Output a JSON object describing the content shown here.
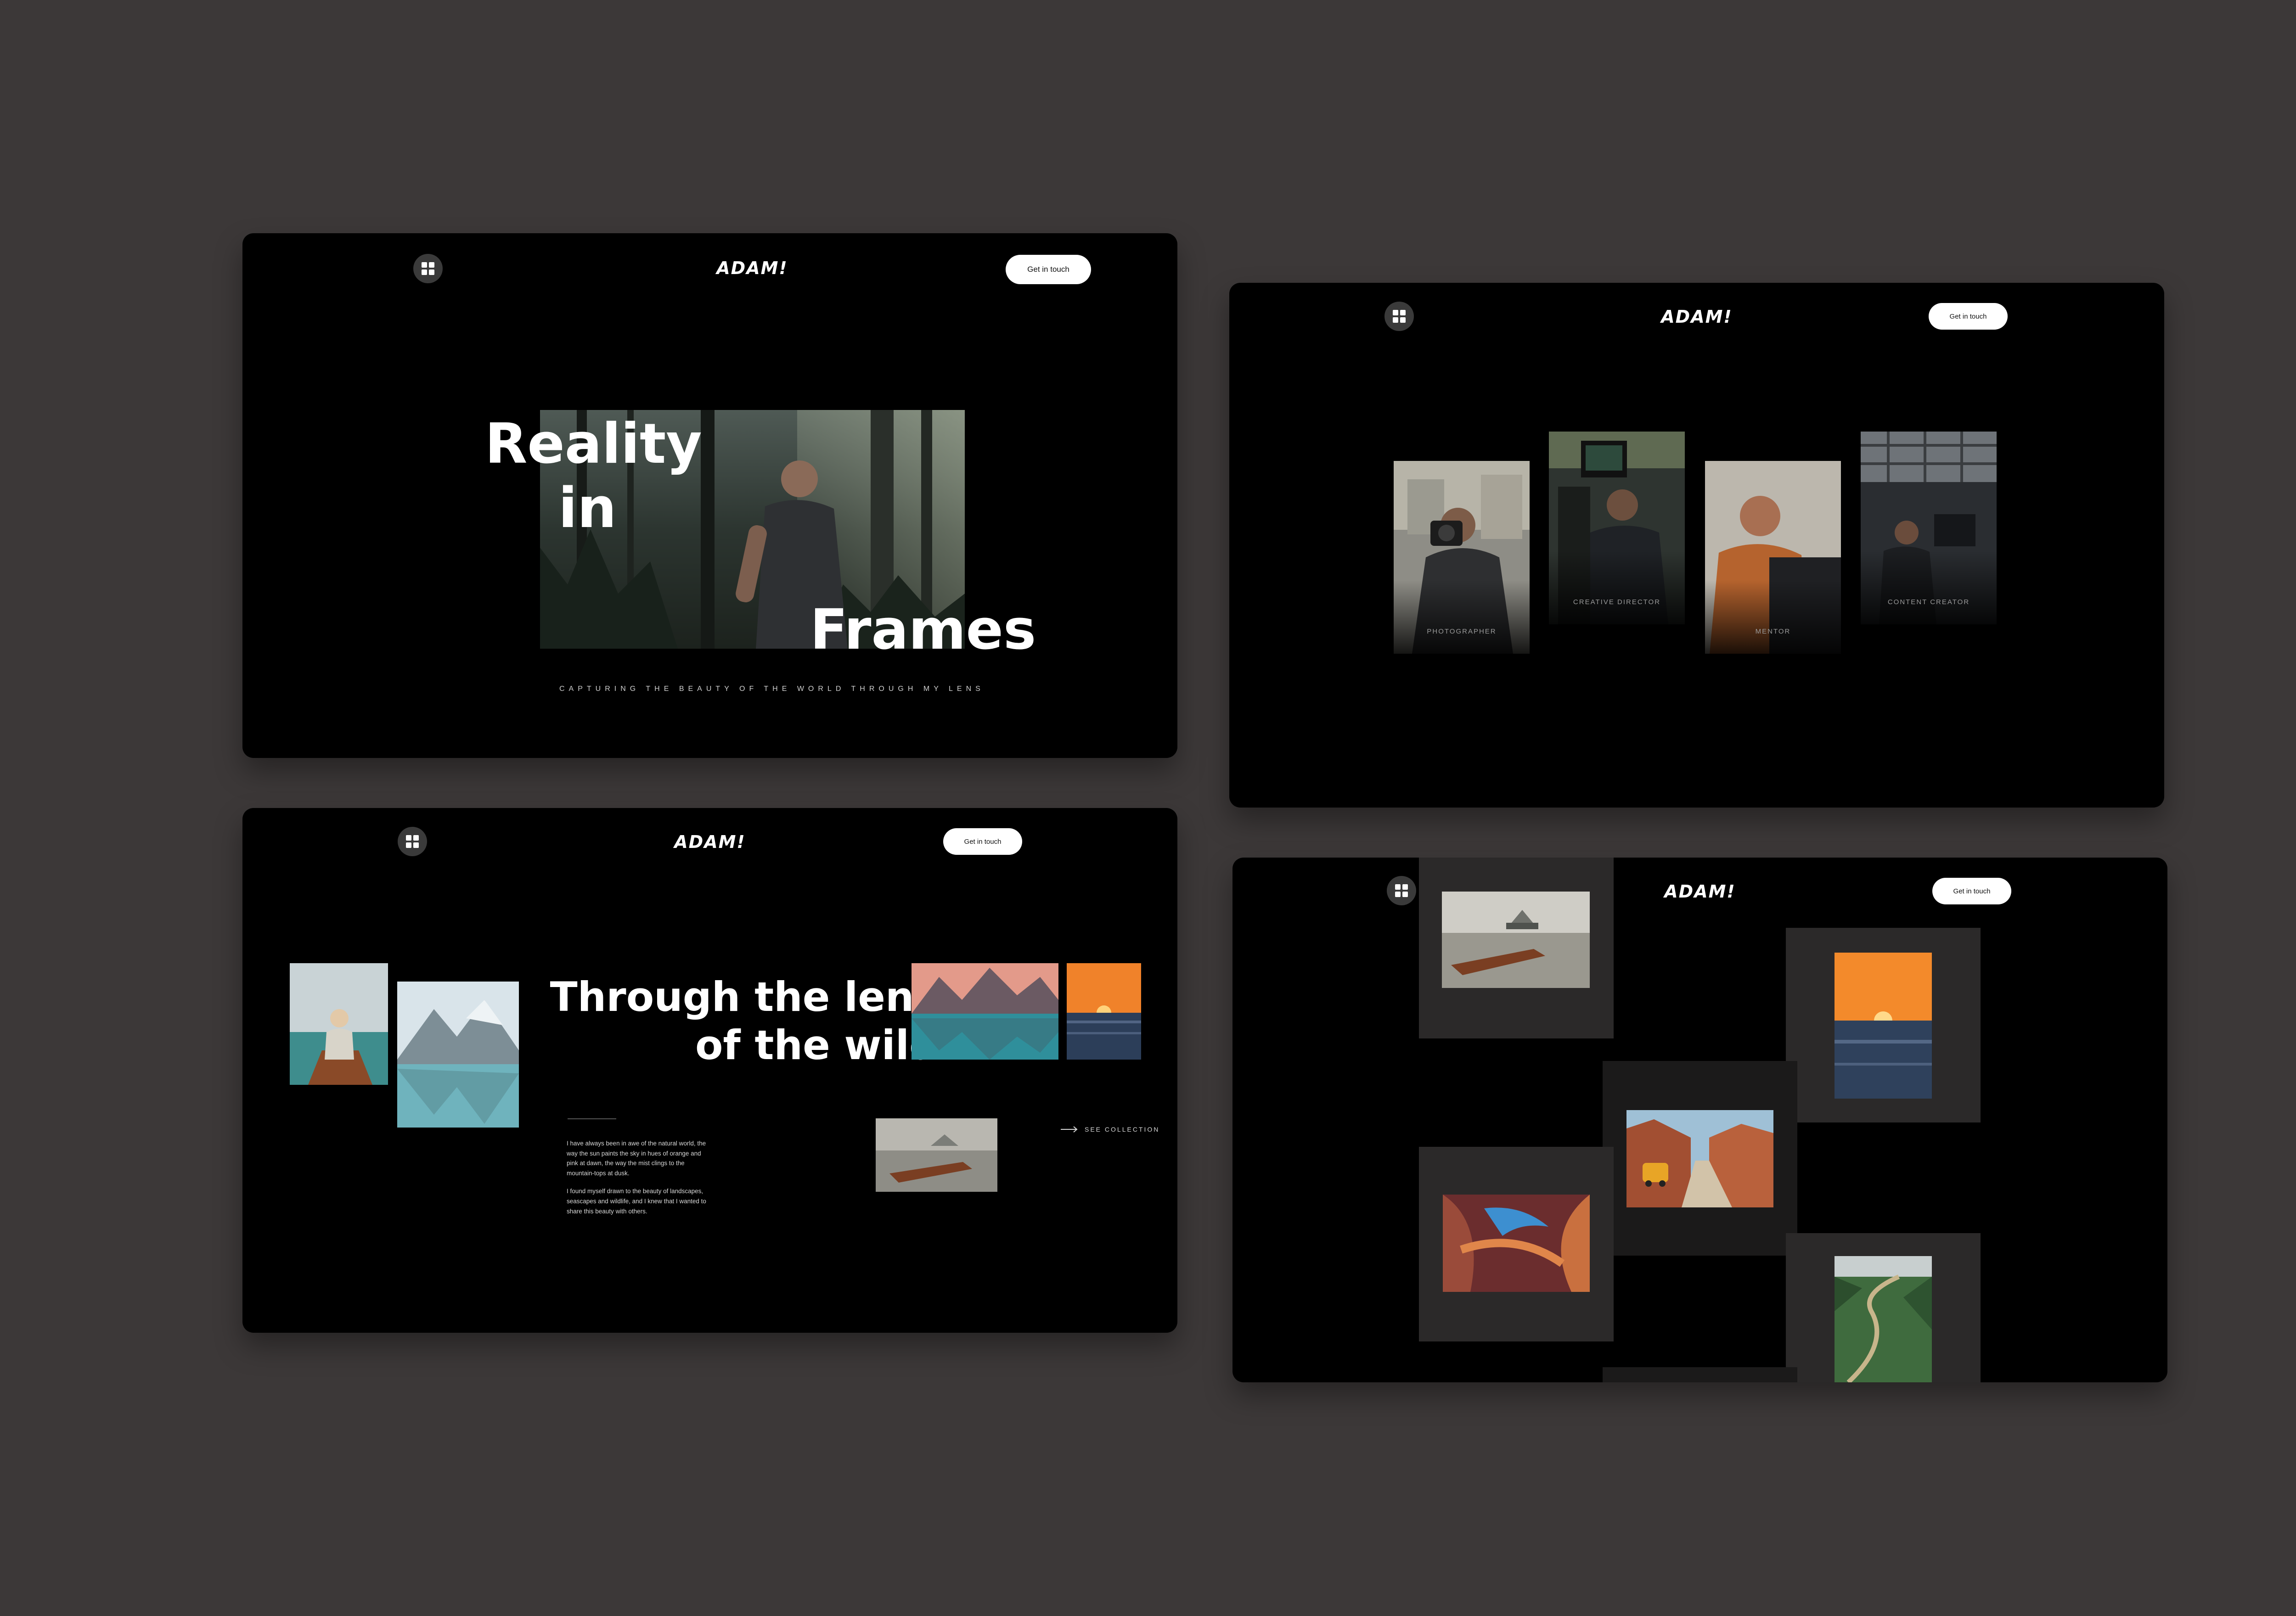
{
  "brand": {
    "logo": "ADAM!",
    "cta_label": "Get in touch"
  },
  "screen_hero": {
    "words": [
      "Reality",
      "in",
      "Frames"
    ],
    "tagline": "CAPTURING THE BEAUTY OF THE WORLD THROUGH MY LENS"
  },
  "screen_roles": {
    "cards": [
      {
        "label": "PHOTOGRAPHER"
      },
      {
        "label": "CREATIVE DIRECTOR"
      },
      {
        "label": "MENTOR"
      },
      {
        "label": "CONTENT CREATOR"
      }
    ]
  },
  "screen_wild": {
    "title_line1": "Through the lens",
    "title_line2": "of the wild",
    "bio_p1": "I have always been in awe of the natural world, the way the sun paints the sky in hues of orange and pink at dawn, the way the mist clings to the mountain-tops at dusk.",
    "bio_p2": "I found myself drawn to the beauty of landscapes, seascapes and wildlife, and I knew that I wanted to share this beauty with others.",
    "see_collection": "SEE COLLECTION"
  },
  "icons": {
    "menu": "grid-icon",
    "arrow": "arrow-right-icon"
  },
  "colors": {
    "background": "#3c3838",
    "frame": "#000000",
    "cta_bg": "#ffffff",
    "tile_dark": "#2b2929"
  }
}
